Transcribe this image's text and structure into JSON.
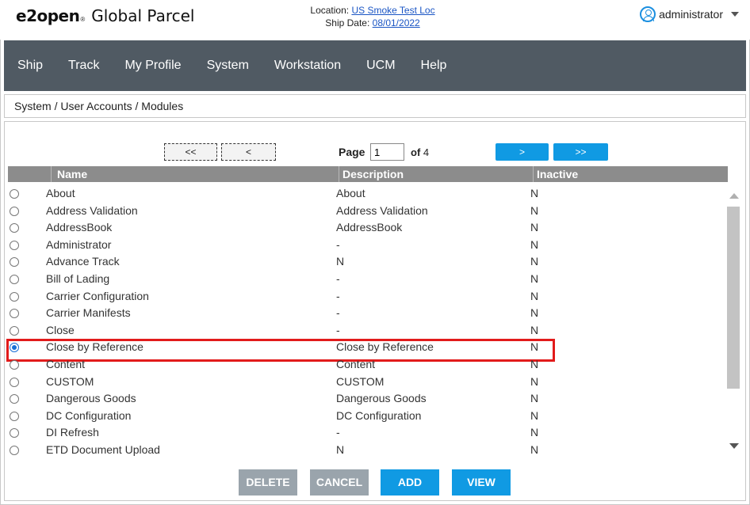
{
  "header": {
    "brand": "e2open",
    "product": "Global Parcel",
    "location_label": "Location:",
    "location_value": "US Smoke Test Loc",
    "ship_date_label": "Ship Date:",
    "ship_date_value": "08/01/2022",
    "user_icon": "user-circle-icon",
    "username": "administrator"
  },
  "nav": {
    "items": [
      "Ship",
      "Track",
      "My Profile",
      "System",
      "Workstation",
      "UCM",
      "Help"
    ]
  },
  "breadcrumb": "System / User Accounts / Modules",
  "pager": {
    "first": "<<",
    "prev": "<",
    "page_label": "Page",
    "page_value": "1",
    "of_label": "of",
    "total": "4",
    "next": ">",
    "last": ">>"
  },
  "table": {
    "columns": [
      "Name",
      "Description",
      "Inactive"
    ],
    "rows": [
      {
        "name": "About",
        "description": "About",
        "inactive": "N",
        "selected": false
      },
      {
        "name": "Address Validation",
        "description": "Address Validation",
        "inactive": "N",
        "selected": false
      },
      {
        "name": "AddressBook",
        "description": "AddressBook",
        "inactive": "N",
        "selected": false
      },
      {
        "name": "Administrator",
        "description": "-",
        "inactive": "N",
        "selected": false
      },
      {
        "name": "Advance Track",
        "description": "N",
        "inactive": "N",
        "selected": false
      },
      {
        "name": "Bill of Lading",
        "description": "-",
        "inactive": "N",
        "selected": false
      },
      {
        "name": "Carrier Configuration",
        "description": "-",
        "inactive": "N",
        "selected": false
      },
      {
        "name": "Carrier Manifests",
        "description": "-",
        "inactive": "N",
        "selected": false
      },
      {
        "name": "Close",
        "description": "-",
        "inactive": "N",
        "selected": false
      },
      {
        "name": "Close by Reference",
        "description": "Close by Reference",
        "inactive": "N",
        "selected": true
      },
      {
        "name": "Content",
        "description": "Content",
        "inactive": "N",
        "selected": false
      },
      {
        "name": "CUSTOM",
        "description": "CUSTOM",
        "inactive": "N",
        "selected": false
      },
      {
        "name": "Dangerous Goods",
        "description": "Dangerous Goods",
        "inactive": "N",
        "selected": false
      },
      {
        "name": "DC Configuration",
        "description": "DC Configuration",
        "inactive": "N",
        "selected": false
      },
      {
        "name": "DI Refresh",
        "description": "-",
        "inactive": "N",
        "selected": false
      },
      {
        "name": "ETD Document Upload",
        "description": "N",
        "inactive": "N",
        "selected": false
      }
    ]
  },
  "actions": {
    "delete": "DELETE",
    "cancel": "CANCEL",
    "add": "ADD",
    "view": "VIEW"
  },
  "colors": {
    "nav_bg": "#505a63",
    "accent_blue": "#109ae3",
    "disabled_gray": "#9aa4ac",
    "highlight_red": "#e21b1b"
  }
}
